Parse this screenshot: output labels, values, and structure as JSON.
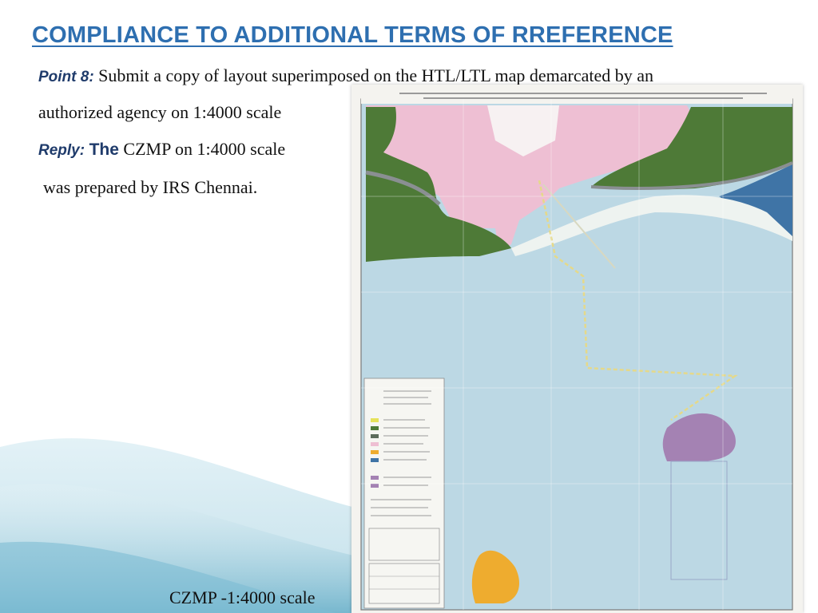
{
  "title": "COMPLIANCE TO ADDITIONAL TERMS OF RREFERENCE",
  "point": {
    "label": "Point 8:",
    "text_line1": "Submit a copy of layout superimposed on the HTL/LTL map demarcated by an",
    "text_line2": "authorized agency on 1:4000 scale"
  },
  "reply": {
    "label": "Reply:",
    "the": "The",
    "text_line1": "CZMP on 1:4000 scale",
    "text_line2": "was prepared by IRS Chennai."
  },
  "map_caption": "CZMP -1:4000 scale",
  "colors": {
    "title": "#2e6fb0",
    "sea": "#bcd8e4",
    "land_pink": "#eebfd3",
    "mangrove_green": "#4e7a37",
    "deep_water": "#3f74a6",
    "purple_zone": "#a482b3",
    "orange_zone": "#eeac2f"
  }
}
